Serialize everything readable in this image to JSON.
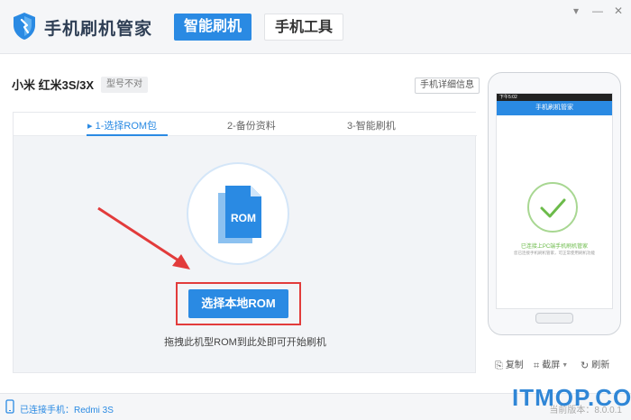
{
  "app": {
    "title": "手机刷机管家"
  },
  "nav": {
    "tabs": [
      {
        "label": "智能刷机",
        "active": true
      },
      {
        "label": "手机工具",
        "active": false
      }
    ]
  },
  "window_controls": {
    "minimize": "▾",
    "min2": "—",
    "close": "✕"
  },
  "device": {
    "name": "小米  红米3S/3X",
    "badge": "型号不对",
    "detail_button": "手机详细信息"
  },
  "steps": [
    {
      "label": "1-选择ROM包",
      "marker": "▸",
      "active": true
    },
    {
      "label": "2-备份资料",
      "active": false
    },
    {
      "label": "3-智能刷机",
      "active": false
    }
  ],
  "rom": {
    "icon_label": "ROM",
    "button": "选择本地ROM",
    "hint": "拖拽此机型ROM到此处即可开始刷机"
  },
  "phone_preview": {
    "status_time": "下午5:02",
    "title": "手机刷机管家",
    "connected": "已连接上PC端手机刷机管家",
    "sub": "您已连接手机刷机管家，可正常使用刷机功能"
  },
  "phone_tools": [
    {
      "label": "复制",
      "icon": "copy-icon",
      "glyph": "⎘"
    },
    {
      "label": "截屏",
      "icon": "crop-icon",
      "glyph": "⌗"
    },
    {
      "label": "刷新",
      "icon": "refresh-icon",
      "glyph": "↻"
    }
  ],
  "status": {
    "connected": "已连接手机：Redmi 3S",
    "version": "当前版本：8.0.0.1"
  },
  "watermark": "ITMOP.COM",
  "colors": {
    "accent": "#2a8ae3",
    "highlight": "#e23b3b",
    "success": "#6cbb4a"
  }
}
